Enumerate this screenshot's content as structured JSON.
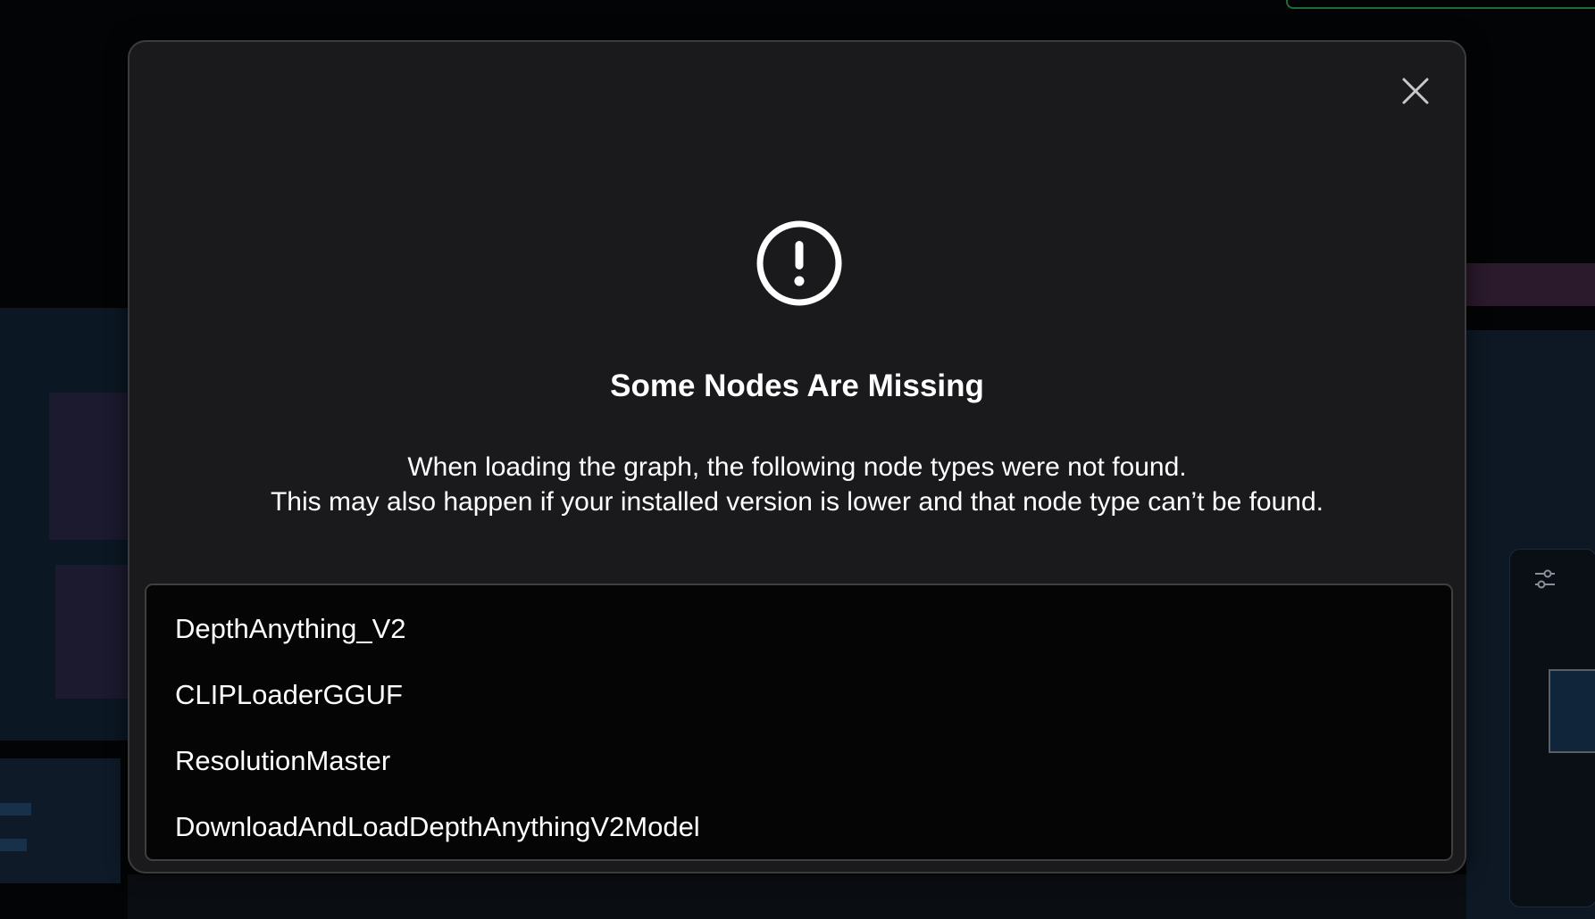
{
  "dialog": {
    "close_icon": "close-icon",
    "warning_icon": "exclamation-circle-icon",
    "title": "Some Nodes Are Missing",
    "message_line1": "When loading the graph, the following node types were not found.",
    "message_line2": "This may also happen if your installed version is lower and that node type can’t be found.",
    "missing_nodes": [
      "DepthAnything_V2",
      "CLIPLoaderGGUF",
      "ResolutionMaster",
      "DownloadAndLoadDepthAnythingV2Model"
    ]
  },
  "background": {
    "settings_icon": "sliders-icon"
  },
  "colors": {
    "dialog_bg": "#1a1a1c",
    "list_bg": "#050506",
    "text": "#ffffff"
  }
}
